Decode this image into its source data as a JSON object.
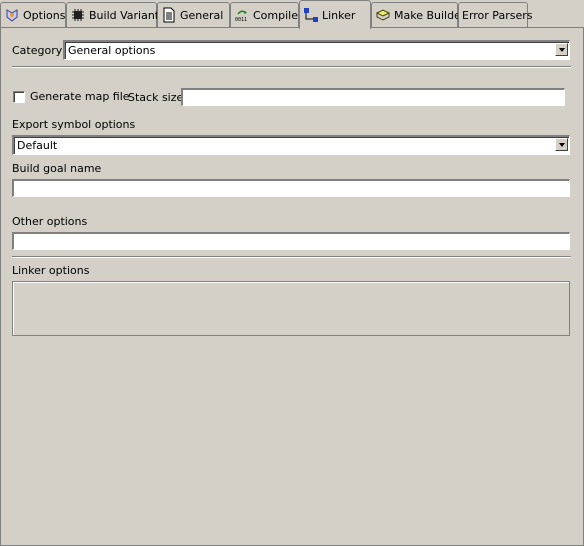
{
  "tabs": [
    {
      "label": "Options",
      "icon": "options-icon"
    },
    {
      "label": "Build Variants",
      "icon": "chip-icon"
    },
    {
      "label": "General",
      "icon": "document-icon"
    },
    {
      "label": "Compiler",
      "icon": "compiler-icon"
    },
    {
      "label": "Linker",
      "icon": "linker-icon",
      "active": true
    },
    {
      "label": "Make Builder",
      "icon": "make-builder-icon"
    },
    {
      "label": "Error Parsers"
    }
  ],
  "category": {
    "label": "Category",
    "value": "General options"
  },
  "generate_map": {
    "label": "Generate map file",
    "checked": false
  },
  "stack_size": {
    "label": "Stack size",
    "value": ""
  },
  "export_symbol": {
    "label": "Export symbol options",
    "value": "Default"
  },
  "build_goal": {
    "label": "Build goal name",
    "value": ""
  },
  "other_options": {
    "label": "Other options",
    "value": ""
  },
  "linker_options": {
    "label": "Linker options",
    "value": ""
  },
  "colors": {
    "background": "#d4d0c8",
    "field": "#ffffff",
    "shadow": "#808080"
  }
}
